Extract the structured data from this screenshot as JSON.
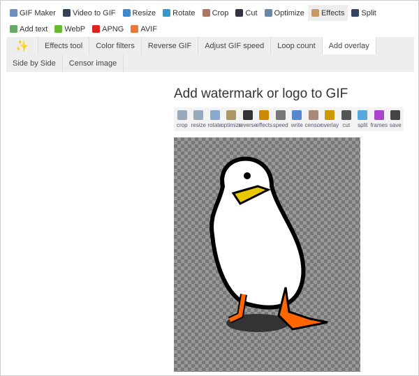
{
  "nav": [
    {
      "label": "GIF Maker",
      "icon": "gif-maker-icon",
      "color": "#6a8fc0"
    },
    {
      "label": "Video to GIF",
      "icon": "video-icon",
      "color": "#345"
    },
    {
      "label": "Resize",
      "icon": "resize-icon",
      "color": "#48c"
    },
    {
      "label": "Rotate",
      "icon": "rotate-icon",
      "color": "#39c"
    },
    {
      "label": "Crop",
      "icon": "crop-icon",
      "color": "#a76"
    },
    {
      "label": "Cut",
      "icon": "cut-icon",
      "color": "#334"
    },
    {
      "label": "Optimize",
      "icon": "optimize-icon",
      "color": "#68a"
    },
    {
      "label": "Effects",
      "icon": "effects-icon",
      "color": "#c96",
      "active": true
    },
    {
      "label": "Split",
      "icon": "split-icon",
      "color": "#346"
    },
    {
      "label": "Add text",
      "icon": "add-text-icon",
      "color": "#6a6"
    },
    {
      "label": "WebP",
      "icon": "webp-icon",
      "color": "#6b3"
    },
    {
      "label": "APNG",
      "icon": "apng-icon",
      "color": "#d22"
    },
    {
      "label": "AVIF",
      "icon": "avif-icon",
      "color": "#e73"
    }
  ],
  "subnav": [
    "Effects tool",
    "Color filters",
    "Reverse GIF",
    "Adjust GIF speed",
    "Loop count",
    "Add overlay",
    "Side by Side",
    "Censor image"
  ],
  "subnav_active": "Add overlay",
  "title": "Add watermark or logo to GIF",
  "tools": [
    "crop",
    "resize",
    "rotate",
    "optimize",
    "reverse",
    "effects",
    "speed",
    "write",
    "censor",
    "overlay",
    "cut",
    "split",
    "frames",
    "save"
  ]
}
